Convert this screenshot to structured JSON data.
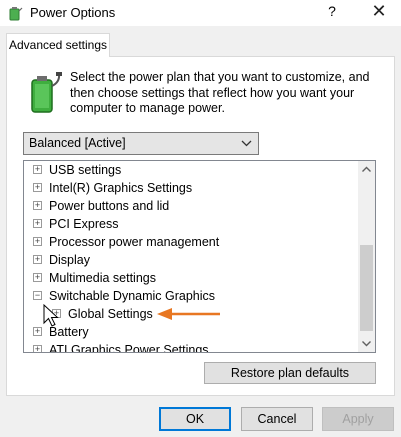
{
  "window": {
    "title": "Power Options",
    "help_label": "?",
    "close_label": "✕"
  },
  "tab": {
    "label": "Advanced settings"
  },
  "description": "Select the power plan that you want to customize, and then choose settings that reflect how you want your computer to manage power.",
  "plan_select": {
    "value": "Balanced [Active]"
  },
  "tree": {
    "items": [
      {
        "label": "USB settings",
        "expander": "+"
      },
      {
        "label": "Intel(R) Graphics Settings",
        "expander": "+"
      },
      {
        "label": "Power buttons and lid",
        "expander": "+"
      },
      {
        "label": "PCI Express",
        "expander": "+"
      },
      {
        "label": "Processor power management",
        "expander": "+"
      },
      {
        "label": "Display",
        "expander": "+"
      },
      {
        "label": "Multimedia settings",
        "expander": "+"
      },
      {
        "label": "Switchable Dynamic Graphics",
        "expander": "−"
      },
      {
        "label": "Global Settings",
        "expander": "+"
      },
      {
        "label": "Battery",
        "expander": "+"
      },
      {
        "label": "ATI Graphics Power Settings",
        "expander": "+"
      }
    ]
  },
  "buttons": {
    "restore": "Restore plan defaults",
    "ok": "OK",
    "cancel": "Cancel",
    "apply": "Apply"
  },
  "colors": {
    "accent": "#0078d7",
    "annotation_arrow": "#e87722"
  },
  "icons": {
    "app": "power-options-icon",
    "battery": "battery-plug-icon",
    "cursor": "mouse-pointer-icon"
  }
}
